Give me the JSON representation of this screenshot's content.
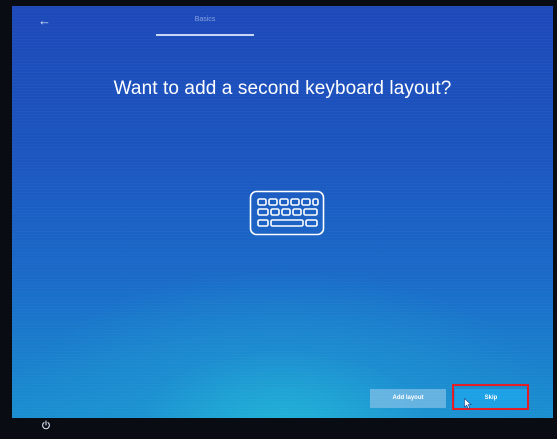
{
  "header": {
    "back_icon": "back-arrow-icon",
    "progress_label": "Basics"
  },
  "main": {
    "title": "Want to add a second keyboard layout?",
    "illustration_icon": "keyboard-icon"
  },
  "actions": {
    "add_layout_label": "Add layout",
    "skip_label": "Skip"
  },
  "footer": {
    "power_icon": "power-icon"
  },
  "colors": {
    "accent": "#1da1e6",
    "highlight": "#e31c24",
    "background_top": "#1d49b9",
    "background_bottom": "#22b8d8"
  }
}
